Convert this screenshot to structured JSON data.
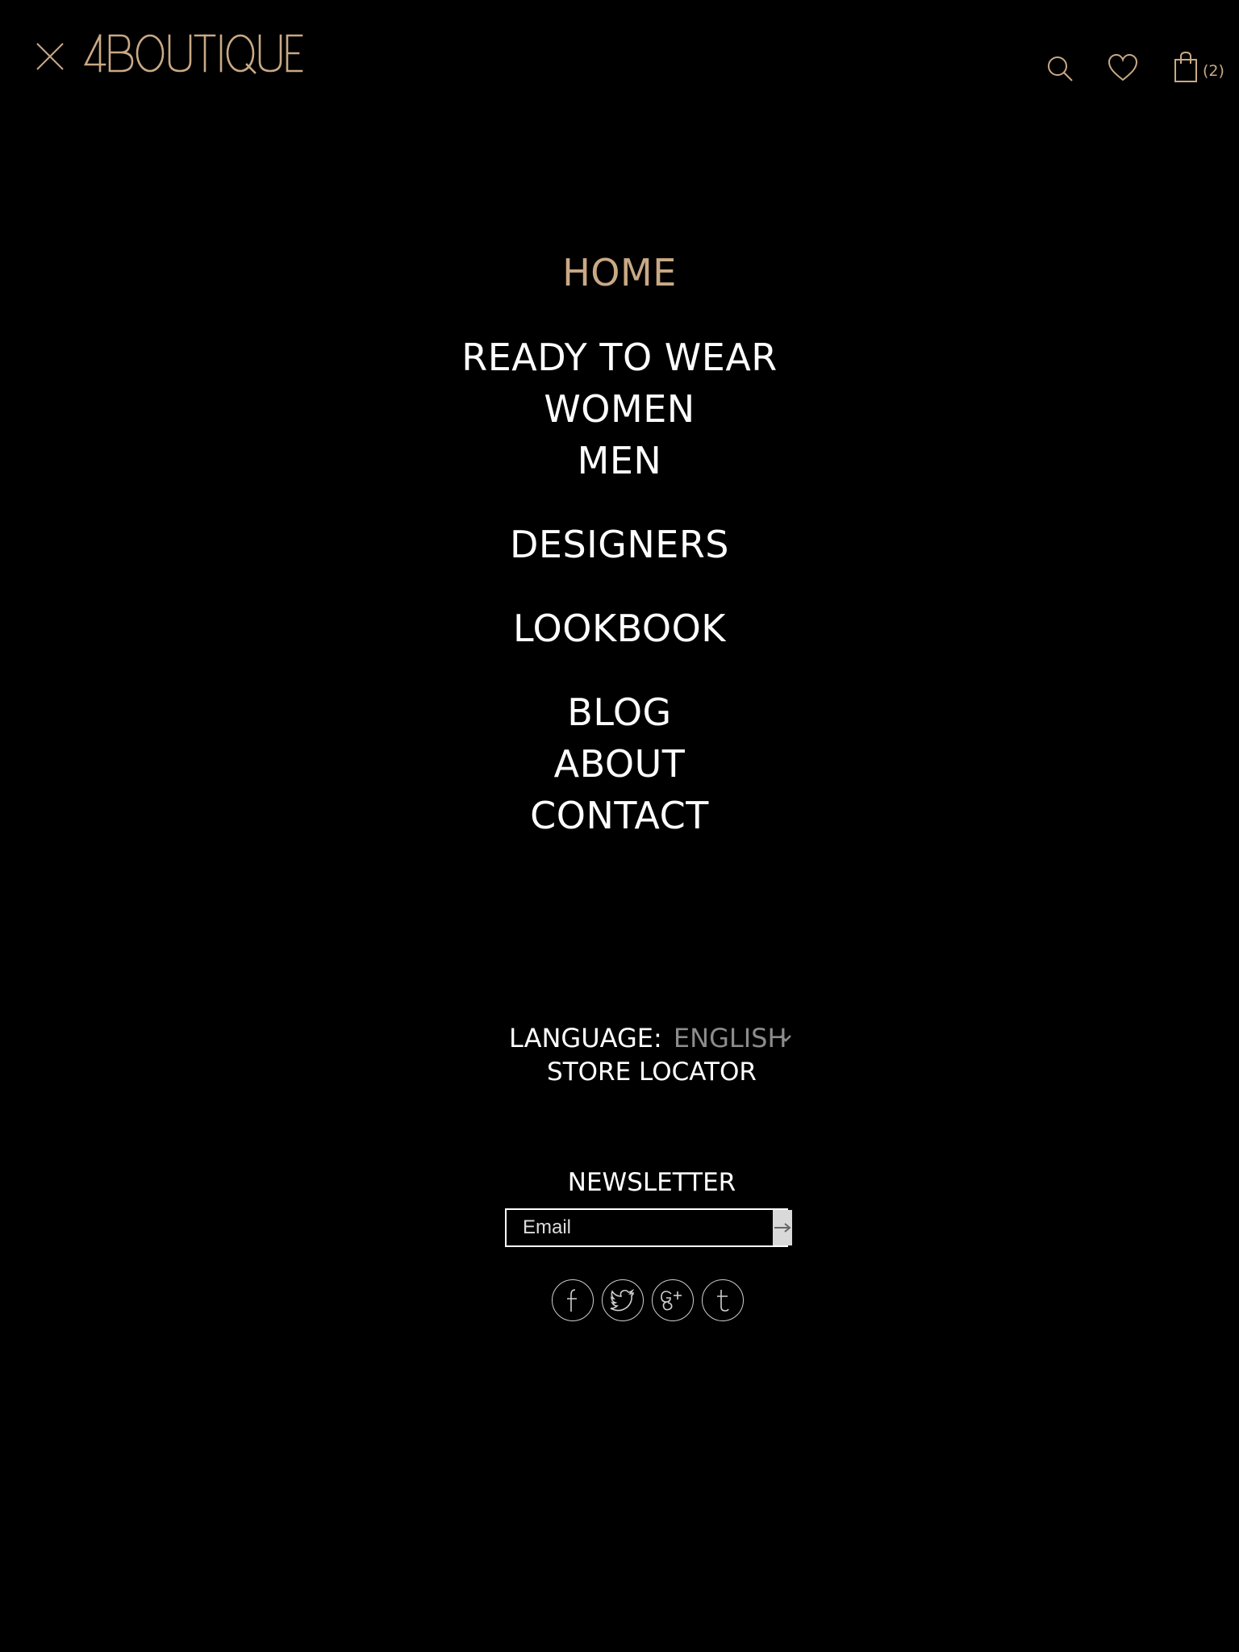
{
  "brand": {
    "logo_text": "4BOUTIQUE",
    "accent_color": "#c9a985",
    "background_color": "#000000"
  },
  "header": {
    "close_icon": "close-icon",
    "search_icon": "search-icon",
    "wishlist_icon": "heart-icon",
    "bag_icon": "shopping-bag-icon",
    "bag_count": "(2)"
  },
  "nav": {
    "items": [
      {
        "label": "HOME",
        "active": true
      },
      {
        "label": "READY TO WEAR",
        "active": false
      },
      {
        "label": "WOMEN",
        "active": false
      },
      {
        "label": "MEN",
        "active": false
      },
      {
        "label": "DESIGNERS",
        "active": false
      },
      {
        "label": "LOOKBOOK",
        "active": false
      },
      {
        "label": "BLOG",
        "active": false
      },
      {
        "label": "ABOUT",
        "active": false
      },
      {
        "label": "CONTACT",
        "active": false
      }
    ]
  },
  "language": {
    "label": "LANGUAGE:",
    "value": "ENGLISH",
    "chevron_icon": "chevron-down-icon"
  },
  "store_locator": {
    "label": "STORE LOCATOR"
  },
  "newsletter": {
    "title": "NEWSLETTER",
    "placeholder": "Email",
    "value": "",
    "submit_icon": "arrow-right-icon"
  },
  "social": [
    {
      "name": "facebook-icon",
      "glyph": "f"
    },
    {
      "name": "twitter-icon",
      "glyph": ""
    },
    {
      "name": "google-plus-icon",
      "glyph": "g+"
    },
    {
      "name": "tumblr-icon",
      "glyph": "t"
    }
  ]
}
